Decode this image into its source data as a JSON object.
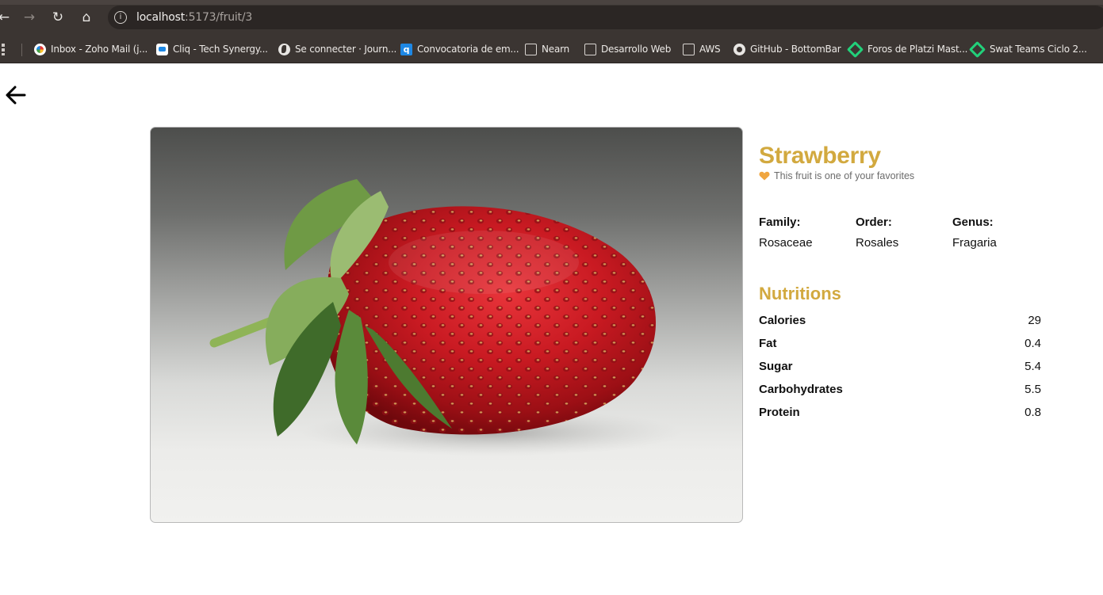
{
  "browser": {
    "url_host": "localhost",
    "url_path": ":5173/fruit/3",
    "bookmarks": [
      {
        "label": "Inbox - Zoho Mail (j...",
        "icon": "zoho-icon"
      },
      {
        "label": "Cliq - Tech Synergy...",
        "icon": "cliq-icon"
      },
      {
        "label": "Se connecter · Journ...",
        "icon": "globe-icon"
      },
      {
        "label": "Convocatoria de em...",
        "icon": "q-icon"
      },
      {
        "label": "Nearn",
        "icon": "folder-icon"
      },
      {
        "label": "Desarrollo Web",
        "icon": "folder-icon"
      },
      {
        "label": "AWS",
        "icon": "folder-icon"
      },
      {
        "label": "GitHub - BottomBar",
        "icon": "github-icon"
      },
      {
        "label": "Foros de Platzi Mast...",
        "icon": "platzi-icon"
      },
      {
        "label": "Swat Teams Ciclo 2...",
        "icon": "platzi-icon"
      }
    ]
  },
  "fruit": {
    "name": "Strawberry",
    "favorite_text": "This fruit is one of your favorites",
    "accent_color": "#d2a93f",
    "taxonomy": [
      {
        "label": "Family:",
        "value": "Rosaceae"
      },
      {
        "label": "Order:",
        "value": "Rosales"
      },
      {
        "label": "Genus:",
        "value": "Fragaria"
      }
    ],
    "nutritions_title": "Nutritions",
    "nutritions": [
      {
        "name": "Calories",
        "value": "29"
      },
      {
        "name": "Fat",
        "value": "0.4"
      },
      {
        "name": "Sugar",
        "value": "5.4"
      },
      {
        "name": "Carbohydrates",
        "value": "5.5"
      },
      {
        "name": "Protein",
        "value": "0.8"
      }
    ]
  }
}
